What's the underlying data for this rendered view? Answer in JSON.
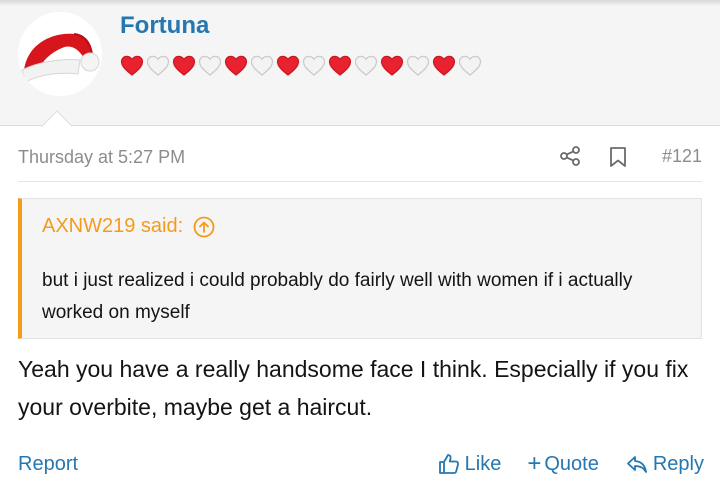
{
  "user": {
    "name": "Fortuna",
    "avatar_icon": "santa-hat-icon",
    "hearts": [
      "red",
      "white",
      "red",
      "white",
      "red",
      "white",
      "red",
      "white",
      "red",
      "white",
      "red",
      "white",
      "red",
      "white"
    ]
  },
  "post": {
    "date": "Thursday at 5:27 PM",
    "number": "#121",
    "share_icon": "share-icon",
    "bookmark_icon": "bookmark-icon"
  },
  "quote": {
    "author": "AXNW219 said:",
    "text": "but i just realized i could probably do fairly well with women if i actually worked on myself"
  },
  "message": {
    "text": "Yeah you have a really handsome face I think. Especially if you fix your overbite, maybe get a haircut."
  },
  "footer": {
    "report": "Report",
    "like": "Like",
    "quote": "Quote",
    "reply": "Reply"
  },
  "colors": {
    "link": "#2577b1",
    "quote_accent": "#f49b1b",
    "heart_red": "#e8232f",
    "heart_white": "#f3f3f3"
  }
}
